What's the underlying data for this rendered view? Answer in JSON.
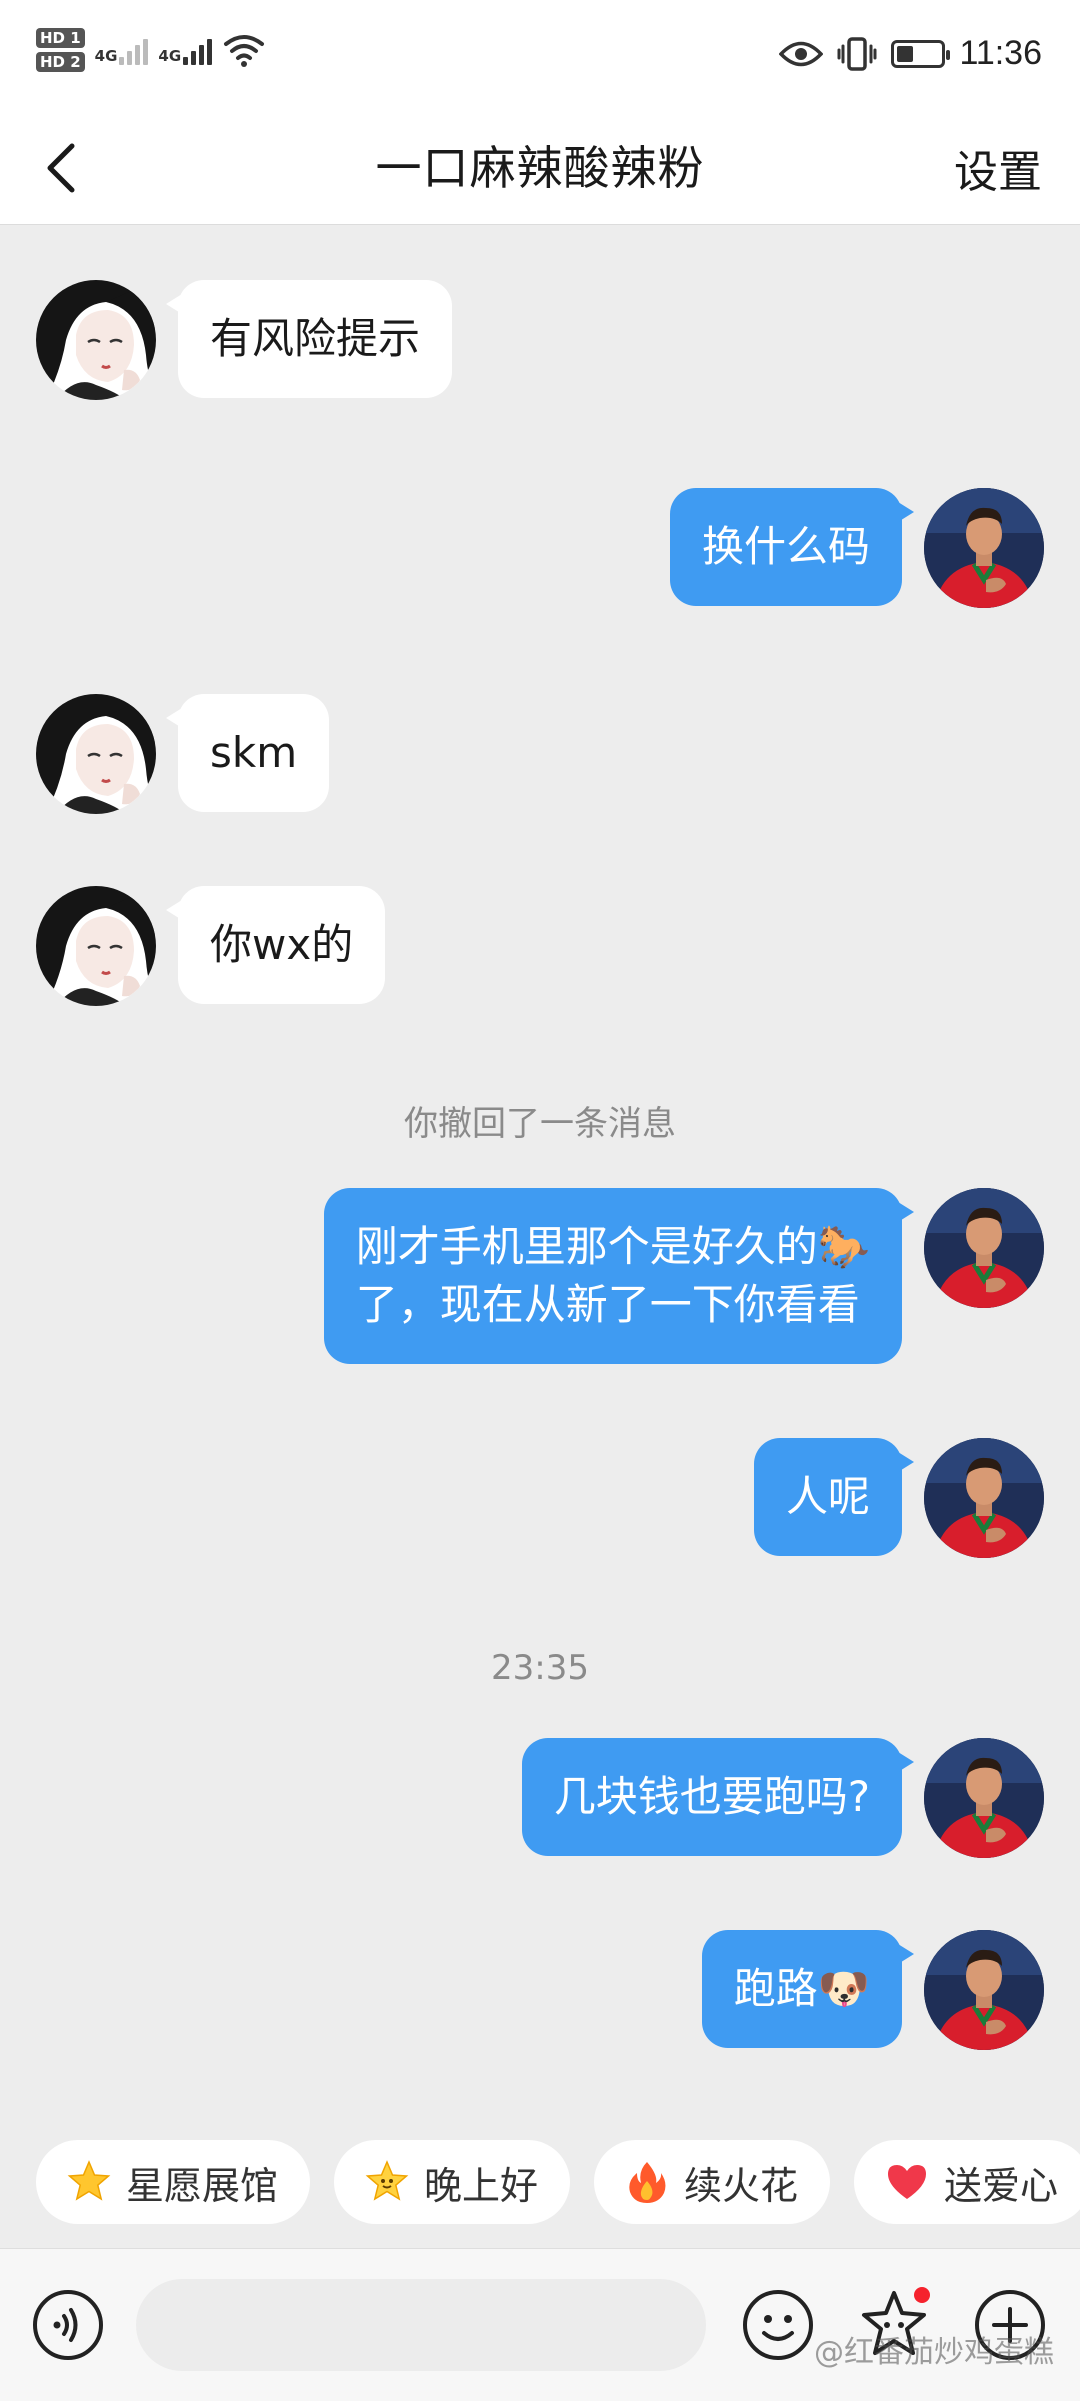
{
  "status_bar": {
    "sim1": "HD 1",
    "sim2": "HD 2",
    "net1": "4G",
    "net2": "4G",
    "time": "11:36"
  },
  "header": {
    "title": "一口麻辣酸辣粉",
    "settings_label": "设置"
  },
  "messages": [
    {
      "side": "in",
      "text": "有风险提示"
    },
    {
      "side": "out",
      "text": "换什么码"
    },
    {
      "side": "in",
      "text": "skm"
    },
    {
      "side": "in",
      "text": "你wx的"
    },
    {
      "type": "system",
      "text": "你撤回了一条消息"
    },
    {
      "side": "out",
      "text_line1": "刚才手机里那个是好久的🐎",
      "text_line2": "了，现在从新了一下你看看"
    },
    {
      "side": "out",
      "text": "人呢"
    },
    {
      "type": "system",
      "text": "23:35"
    },
    {
      "side": "out",
      "text": "几块钱也要跑吗?"
    },
    {
      "side": "out",
      "text": "跑路🐶"
    }
  ],
  "quick_chips": [
    {
      "icon": "star-icon",
      "label": "星愿展馆"
    },
    {
      "icon": "star-face-icon",
      "label": "晚上好"
    },
    {
      "icon": "fire-icon",
      "label": "续火花"
    },
    {
      "icon": "heart-icon",
      "label": "送爱心"
    }
  ],
  "input_bar": {
    "placeholder": ""
  },
  "watermark": "@红番茄炒鸡蛋糕",
  "colors": {
    "outgoing_bubble": "#3f9bf2",
    "incoming_bubble": "#ffffff",
    "background": "#ededed",
    "badge_red": "#f5222d"
  }
}
